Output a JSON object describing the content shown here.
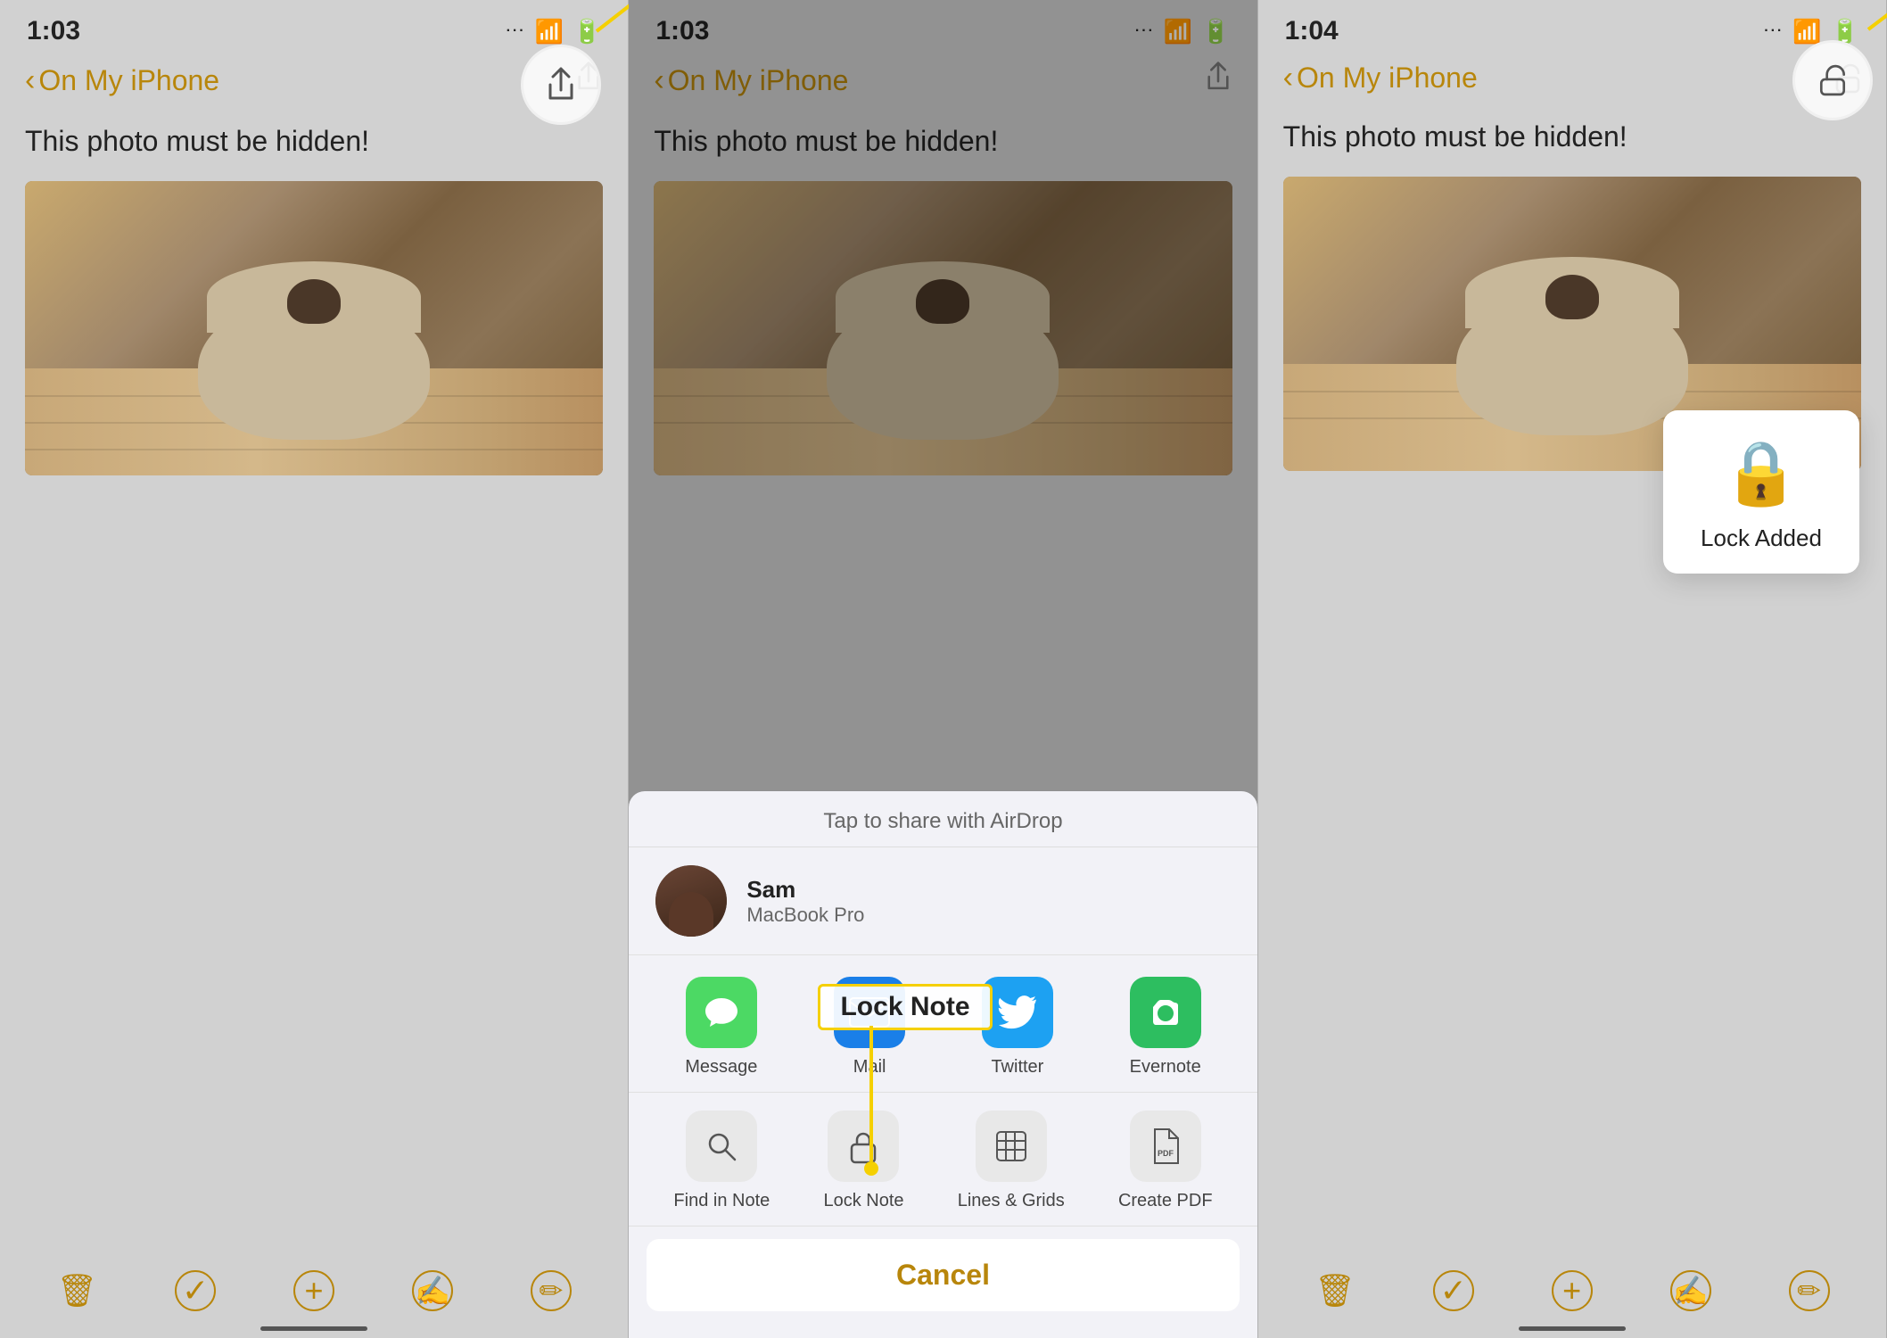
{
  "panels": [
    {
      "id": "left",
      "time": "1:03",
      "nav_back": "On My iPhone",
      "note_title": "This photo must be hidden!",
      "annotation": "share_button",
      "bottom_icons": [
        "trash",
        "check",
        "plus",
        "compose-pen",
        "edit"
      ]
    },
    {
      "id": "middle",
      "time": "1:03",
      "nav_back": "On My iPhone",
      "note_title": "This photo must be hidden!",
      "share_sheet": {
        "airdrop_label": "Tap to share with AirDrop",
        "contact_name": "Sam",
        "contact_device": "MacBook Pro",
        "apps": [
          {
            "label": "Message",
            "icon": "message"
          },
          {
            "label": "Mail",
            "icon": "mail"
          },
          {
            "label": "Twitter",
            "icon": "twitter"
          },
          {
            "label": "Evernote",
            "icon": "evernote"
          }
        ],
        "actions": [
          {
            "label": "Find in Note",
            "icon": "🔍"
          },
          {
            "label": "Lock Note",
            "icon": "🔒"
          },
          {
            "label": "Lines & Grids",
            "icon": "⊞"
          },
          {
            "label": "Create PDF",
            "icon": "📄"
          }
        ],
        "cancel_label": "Cancel"
      },
      "lock_note_highlight": "Lock Note",
      "annotation": "lock_note_action"
    },
    {
      "id": "right",
      "time": "1:04",
      "nav_back": "On My iPhone",
      "note_title": "This photo must be hidden!",
      "lock_added": {
        "label": "Lock Added"
      },
      "annotation": "unlock_button",
      "bottom_icons": [
        "trash",
        "check",
        "plus",
        "compose-pen",
        "edit"
      ]
    }
  ]
}
